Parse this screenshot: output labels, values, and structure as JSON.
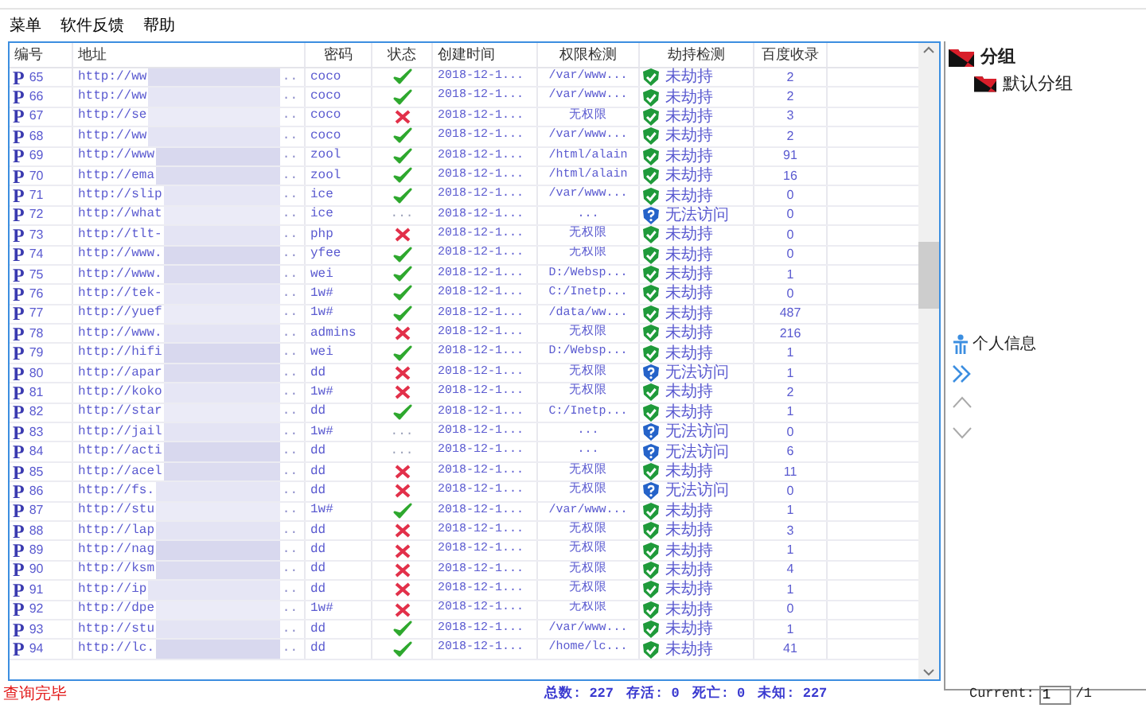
{
  "menu": [
    "菜单",
    "软件反馈",
    "帮助"
  ],
  "table": {
    "columns": [
      "编号",
      "地址",
      "密码",
      "状态",
      "创建时间",
      "权限检测",
      "劫持检测",
      "百度收录"
    ],
    "rows": [
      {
        "mark": "P",
        "id": "65",
        "address_start": "http://ww",
        "address_end": "..",
        "password": "coco",
        "status": {
          "kind": "ok"
        },
        "created": "2018-12-1...",
        "permission": "/var/www...",
        "hijack": {
          "kind": "safe",
          "text": "未劫持"
        },
        "indexed": "2"
      },
      {
        "mark": "P",
        "id": "66",
        "address_start": "http://ww",
        "address_end": "..",
        "password": "coco",
        "status": {
          "kind": "ok"
        },
        "created": "2018-12-1...",
        "permission": "/var/www...",
        "hijack": {
          "kind": "safe",
          "text": "未劫持"
        },
        "indexed": "2"
      },
      {
        "mark": "P",
        "id": "67",
        "address_start": "http://se",
        "address_end": "..",
        "password": "coco",
        "status": {
          "kind": "fail"
        },
        "created": "2018-12-1...",
        "permission": "无权限",
        "hijack": {
          "kind": "safe",
          "text": "未劫持"
        },
        "indexed": "3"
      },
      {
        "mark": "P",
        "id": "68",
        "address_start": "http://ww",
        "address_end": "..",
        "password": "coco",
        "status": {
          "kind": "ok"
        },
        "created": "2018-12-1...",
        "permission": "/var/www...",
        "hijack": {
          "kind": "safe",
          "text": "未劫持"
        },
        "indexed": "2"
      },
      {
        "mark": "P",
        "id": "69",
        "address_start": "http://www",
        "address_end": "..",
        "password": "zool",
        "status": {
          "kind": "ok"
        },
        "created": "2018-12-1...",
        "permission": "/html/alain",
        "hijack": {
          "kind": "safe",
          "text": "未劫持"
        },
        "indexed": "91"
      },
      {
        "mark": "P",
        "id": "70",
        "address_start": "http://ema",
        "address_end": "..",
        "password": "zool",
        "status": {
          "kind": "ok"
        },
        "created": "2018-12-1...",
        "permission": "/html/alain",
        "hijack": {
          "kind": "safe",
          "text": "未劫持"
        },
        "indexed": "16"
      },
      {
        "mark": "P",
        "id": "71",
        "address_start": "http://slip",
        "address_end": "..",
        "password": "ice",
        "status": {
          "kind": "ok"
        },
        "created": "2018-12-1...",
        "permission": "/var/www...",
        "hijack": {
          "kind": "safe",
          "text": "未劫持"
        },
        "indexed": "0"
      },
      {
        "mark": "P",
        "id": "72",
        "address_start": "http://what",
        "address_end": "..",
        "password": "ice",
        "status": {
          "kind": "pending",
          "text": "..."
        },
        "created": "2018-12-1...",
        "permission": "...",
        "hijack": {
          "kind": "unknown",
          "text": "无法访问"
        },
        "indexed": "0"
      },
      {
        "mark": "P",
        "id": "73",
        "address_start": "http://tlt-",
        "address_end": "..",
        "password": "php",
        "status": {
          "kind": "fail"
        },
        "created": "2018-12-1...",
        "permission": "无权限",
        "hijack": {
          "kind": "safe",
          "text": "未劫持"
        },
        "indexed": "0"
      },
      {
        "mark": "P",
        "id": "74",
        "address_start": "http://www.",
        "address_end": "..",
        "password": "yfee",
        "status": {
          "kind": "ok"
        },
        "created": "2018-12-1...",
        "permission": "无权限",
        "hijack": {
          "kind": "safe",
          "text": "未劫持"
        },
        "indexed": "0"
      },
      {
        "mark": "P",
        "id": "75",
        "address_start": "http://www.",
        "address_end": "..",
        "password": "wei",
        "status": {
          "kind": "ok"
        },
        "created": "2018-12-1...",
        "permission": "D:/Websp...",
        "hijack": {
          "kind": "safe",
          "text": "未劫持"
        },
        "indexed": "1"
      },
      {
        "mark": "P",
        "id": "76",
        "address_start": "http://tek-",
        "address_end": "..",
        "password": "1w#",
        "status": {
          "kind": "ok"
        },
        "created": "2018-12-1...",
        "permission": "C:/Inetp...",
        "hijack": {
          "kind": "safe",
          "text": "未劫持"
        },
        "indexed": "0"
      },
      {
        "mark": "P",
        "id": "77",
        "address_start": "http://yuef",
        "address_end": "..",
        "password": "1w#",
        "status": {
          "kind": "ok"
        },
        "created": "2018-12-1...",
        "permission": "/data/ww...",
        "hijack": {
          "kind": "safe",
          "text": "未劫持"
        },
        "indexed": "487"
      },
      {
        "mark": "P",
        "id": "78",
        "address_start": "http://www.",
        "address_end": "..",
        "password": "admins",
        "status": {
          "kind": "fail"
        },
        "created": "2018-12-1...",
        "permission": "无权限",
        "hijack": {
          "kind": "safe",
          "text": "未劫持"
        },
        "indexed": "216"
      },
      {
        "mark": "P",
        "id": "79",
        "address_start": "http://hifi",
        "address_end": "..",
        "password": "wei",
        "status": {
          "kind": "ok"
        },
        "created": "2018-12-1...",
        "permission": "D:/Websp...",
        "hijack": {
          "kind": "safe",
          "text": "未劫持"
        },
        "indexed": "1"
      },
      {
        "mark": "P",
        "id": "80",
        "address_start": "http://apar",
        "address_end": "..",
        "password": "dd",
        "status": {
          "kind": "fail"
        },
        "created": "2018-12-1...",
        "permission": "无权限",
        "hijack": {
          "kind": "unknown",
          "text": "无法访问"
        },
        "indexed": "1"
      },
      {
        "mark": "P",
        "id": "81",
        "address_start": "http://koko",
        "address_end": "..",
        "password": "1w#",
        "status": {
          "kind": "fail"
        },
        "created": "2018-12-1...",
        "permission": "无权限",
        "hijack": {
          "kind": "safe",
          "text": "未劫持"
        },
        "indexed": "2"
      },
      {
        "mark": "P",
        "id": "82",
        "address_start": "http://star",
        "address_end": "..",
        "password": "dd",
        "status": {
          "kind": "ok"
        },
        "created": "2018-12-1...",
        "permission": "C:/Inetp...",
        "hijack": {
          "kind": "safe",
          "text": "未劫持"
        },
        "indexed": "1"
      },
      {
        "mark": "P",
        "id": "83",
        "address_start": "http://jail",
        "address_end": "..",
        "password": "1w#",
        "status": {
          "kind": "pending",
          "text": "..."
        },
        "created": "2018-12-1...",
        "permission": "...",
        "hijack": {
          "kind": "unknown",
          "text": "无法访问"
        },
        "indexed": "0"
      },
      {
        "mark": "P",
        "id": "84",
        "address_start": "http://acti",
        "address_end": "..",
        "password": "dd",
        "status": {
          "kind": "pending",
          "text": "..."
        },
        "created": "2018-12-1...",
        "permission": "...",
        "hijack": {
          "kind": "unknown",
          "text": "无法访问"
        },
        "indexed": "6"
      },
      {
        "mark": "P",
        "id": "85",
        "address_start": "http://acel",
        "address_end": "..",
        "password": "dd",
        "status": {
          "kind": "fail"
        },
        "created": "2018-12-1...",
        "permission": "无权限",
        "hijack": {
          "kind": "safe",
          "text": "未劫持"
        },
        "indexed": "11"
      },
      {
        "mark": "P",
        "id": "86",
        "address_start": "http://fs.",
        "address_end": "..",
        "password": "dd",
        "status": {
          "kind": "fail"
        },
        "created": "2018-12-1...",
        "permission": "无权限",
        "hijack": {
          "kind": "unknown",
          "text": "无法访问"
        },
        "indexed": "0"
      },
      {
        "mark": "P",
        "id": "87",
        "address_start": "http://stu",
        "address_end": "..",
        "password": "1w#",
        "status": {
          "kind": "ok"
        },
        "created": "2018-12-1...",
        "permission": "/var/www...",
        "hijack": {
          "kind": "safe",
          "text": "未劫持"
        },
        "indexed": "1"
      },
      {
        "mark": "P",
        "id": "88",
        "address_start": "http://lap",
        "address_end": "..",
        "password": "dd",
        "status": {
          "kind": "fail"
        },
        "created": "2018-12-1...",
        "permission": "无权限",
        "hijack": {
          "kind": "safe",
          "text": "未劫持"
        },
        "indexed": "3"
      },
      {
        "mark": "P",
        "id": "89",
        "address_start": "http://nag",
        "address_end": "..",
        "password": "dd",
        "status": {
          "kind": "fail"
        },
        "created": "2018-12-1...",
        "permission": "无权限",
        "hijack": {
          "kind": "safe",
          "text": "未劫持"
        },
        "indexed": "1"
      },
      {
        "mark": "P",
        "id": "90",
        "address_start": "http://ksm",
        "address_end": "..",
        "password": "dd",
        "status": {
          "kind": "fail"
        },
        "created": "2018-12-1...",
        "permission": "无权限",
        "hijack": {
          "kind": "safe",
          "text": "未劫持"
        },
        "indexed": "4"
      },
      {
        "mark": "P",
        "id": "91",
        "address_start": "http://ip",
        "address_end": "..",
        "password": "dd",
        "status": {
          "kind": "fail"
        },
        "created": "2018-12-1...",
        "permission": "无权限",
        "hijack": {
          "kind": "safe",
          "text": "未劫持"
        },
        "indexed": "1"
      },
      {
        "mark": "P",
        "id": "92",
        "address_start": "http://dpe",
        "address_end": "..",
        "password": "1w#",
        "status": {
          "kind": "fail"
        },
        "created": "2018-12-1...",
        "permission": "无权限",
        "hijack": {
          "kind": "safe",
          "text": "未劫持"
        },
        "indexed": "0"
      },
      {
        "mark": "P",
        "id": "93",
        "address_start": "http://stu",
        "address_end": "..",
        "password": "dd",
        "status": {
          "kind": "ok"
        },
        "created": "2018-12-1...",
        "permission": "/var/www...",
        "hijack": {
          "kind": "safe",
          "text": "未劫持"
        },
        "indexed": "1"
      },
      {
        "mark": "P",
        "id": "94",
        "address_start": "http://lc.",
        "address_end": "..",
        "password": "dd",
        "status": {
          "kind": "ok"
        },
        "created": "2018-12-1...",
        "permission": "/home/lc...",
        "hijack": {
          "kind": "safe",
          "text": "未劫持"
        },
        "indexed": "41"
      }
    ]
  },
  "tree": [
    {
      "label": "分组",
      "children": [
        {
          "label": "默认分组"
        }
      ]
    }
  ],
  "profile": {
    "label": "个人信息"
  },
  "status_bar": {
    "message": "查询完毕",
    "totals": [
      "总数: 227",
      "存活: 0",
      "死亡: 0",
      "未知: 227"
    ],
    "page_label": "Current:",
    "page_value": "1",
    "page_total": "/1"
  }
}
